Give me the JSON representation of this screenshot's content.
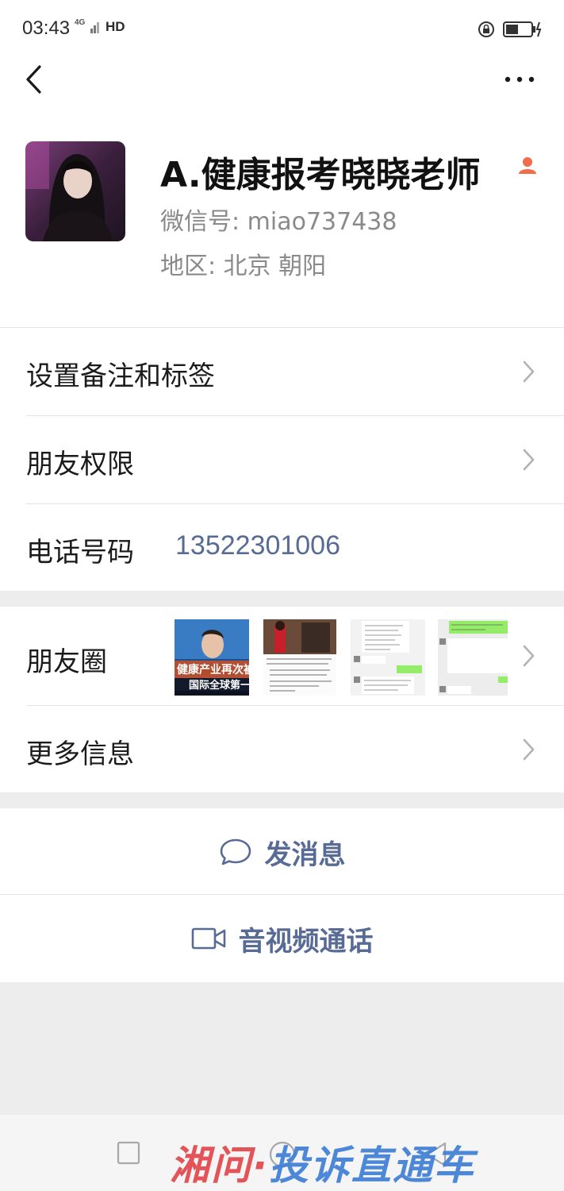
{
  "status_bar": {
    "time": "03:43",
    "signal": "4G",
    "hd": "HD"
  },
  "profile": {
    "name": "A.健康报考晓晓老师",
    "wechat_id": "微信号: miao737438",
    "region": "地区: 北京  朝阳"
  },
  "rows": {
    "remark_label": "设置备注和标签",
    "permissions_label": "朋友权限",
    "phone_label": "电话号码",
    "phone_value": "13522301006",
    "moments_label": "朋友圈",
    "more_info_label": "更多信息"
  },
  "moments_thumbs": [
    {
      "caption_line1": "健康产业再次被",
      "caption_line2": "国际全球第一"
    },
    {
      "caption_line1": "",
      "caption_line2": ""
    },
    {
      "caption_line1": "",
      "caption_line2": ""
    },
    {
      "caption_line1": "",
      "caption_line2": ""
    }
  ],
  "actions": {
    "send_message": "发消息",
    "av_call": "音视频通话"
  },
  "watermark": {
    "part1": "湘问·",
    "part2": "投诉直通车"
  },
  "colors": {
    "link_blue": "#576b95",
    "badge_orange": "#f06c4b",
    "page_bg": "#ededed"
  }
}
